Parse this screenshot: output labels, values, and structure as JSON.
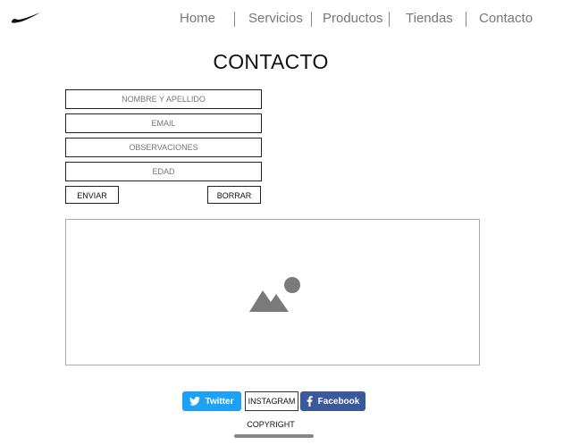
{
  "nav": {
    "items": [
      {
        "label": "Home"
      },
      {
        "label": "Servicios"
      },
      {
        "label": "Productos"
      },
      {
        "label": "Tiendas"
      },
      {
        "label": "Contacto"
      }
    ]
  },
  "page": {
    "title": "CONTACTO"
  },
  "form": {
    "fields": [
      {
        "placeholder": "NOMBRE Y APELLIDO"
      },
      {
        "placeholder": "EMAIL"
      },
      {
        "placeholder": "OBSERVACIONES"
      },
      {
        "placeholder": "EDAD"
      }
    ],
    "submit_label": "ENVIAR",
    "reset_label": "BORRAR"
  },
  "media": {
    "icon": "image-placeholder-icon"
  },
  "footer": {
    "twitter_label": "Twitter",
    "instagram_label": "INSTAGRAM",
    "facebook_label": "Facebook",
    "copyright": "COPYRIGHT"
  },
  "colors": {
    "twitter": "#1da1f2",
    "facebook": "#3b5998",
    "nav_text": "#777777"
  }
}
